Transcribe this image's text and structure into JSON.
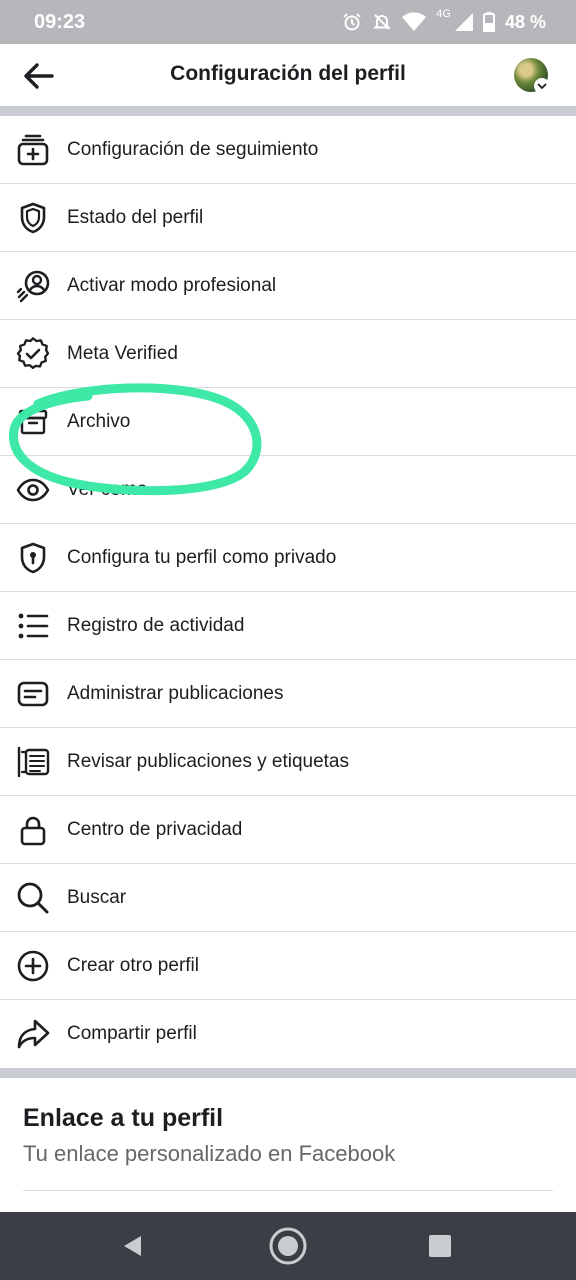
{
  "status_bar": {
    "time": "09:23",
    "network": "4G",
    "battery": "48 %"
  },
  "header": {
    "title": "Configuración del perfil"
  },
  "menu": {
    "items": [
      {
        "label": "Configuración de seguimiento",
        "icon": "follow-settings-icon"
      },
      {
        "label": "Estado del perfil",
        "icon": "shield-icon"
      },
      {
        "label": "Activar modo profesional",
        "icon": "professional-mode-icon"
      },
      {
        "label": "Meta Verified",
        "icon": "verified-badge-icon"
      },
      {
        "label": "Archivo",
        "icon": "archive-icon"
      },
      {
        "label": "Ver como",
        "icon": "eye-icon"
      },
      {
        "label": "Configura tu perfil como privado",
        "icon": "private-shield-icon"
      },
      {
        "label": "Registro de actividad",
        "icon": "list-icon"
      },
      {
        "label": "Administrar publicaciones",
        "icon": "posts-icon"
      },
      {
        "label": "Revisar publicaciones y etiquetas",
        "icon": "review-posts-icon"
      },
      {
        "label": "Centro de privacidad",
        "icon": "lock-icon"
      },
      {
        "label": "Buscar",
        "icon": "search-icon"
      },
      {
        "label": "Crear otro perfil",
        "icon": "add-circle-icon"
      },
      {
        "label": "Compartir perfil",
        "icon": "share-icon"
      }
    ]
  },
  "profile_link": {
    "title": "Enlace a tu perfil",
    "subtitle": "Tu enlace personalizado en Facebook"
  },
  "colors": {
    "annotation": "#3ee8a6",
    "divider": "#dadde1",
    "nav_bar": "#3b3e44"
  }
}
